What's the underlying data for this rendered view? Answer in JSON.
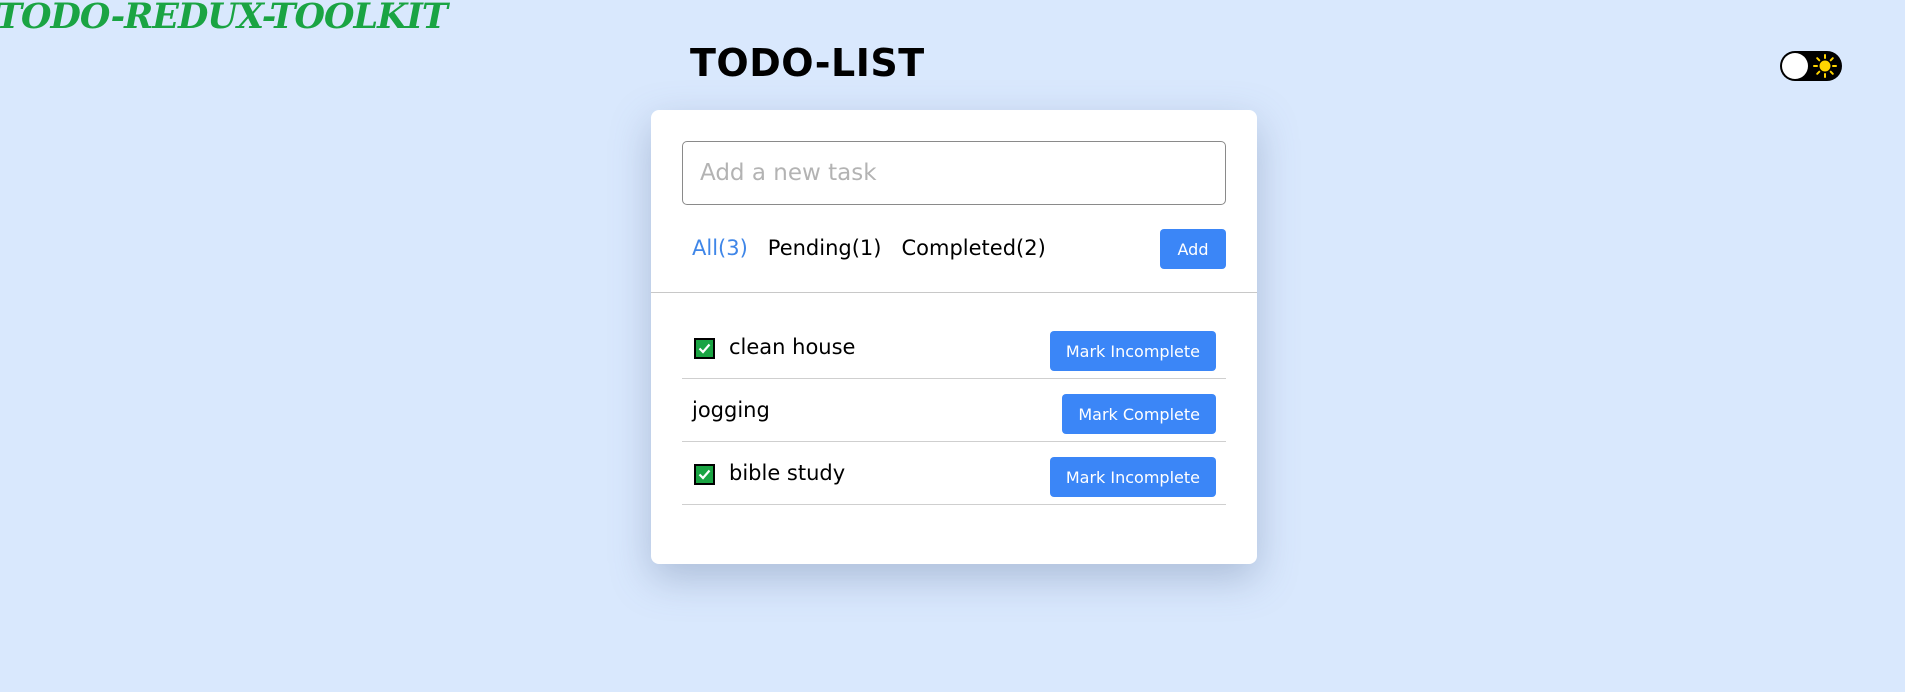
{
  "app": {
    "logo_text": "TODO-REDUX-TOOLKIT",
    "title": "TODO-LIST"
  },
  "theme_toggle": {
    "icon": "sun-icon",
    "knob_color": "#ffffff",
    "track_color": "#000000"
  },
  "input": {
    "value": "",
    "placeholder": "Add a new task"
  },
  "filters": [
    {
      "label": "All(3)",
      "active": true
    },
    {
      "label": "Pending(1)",
      "active": false
    },
    {
      "label": "Completed(2)",
      "active": false
    }
  ],
  "add_button": {
    "label": "Add"
  },
  "tasks": [
    {
      "text": "clean house",
      "completed": true,
      "action_label": "Mark Incomplete"
    },
    {
      "text": "jogging",
      "completed": false,
      "action_label": "Mark Complete"
    },
    {
      "text": "bible study",
      "completed": true,
      "action_label": "Mark Incomplete"
    }
  ],
  "colors": {
    "background": "#d9e8fd",
    "accent": "#3b86f7",
    "active_filter": "#3f86e8",
    "logo": "#1aa443",
    "check": "#1aa443"
  }
}
